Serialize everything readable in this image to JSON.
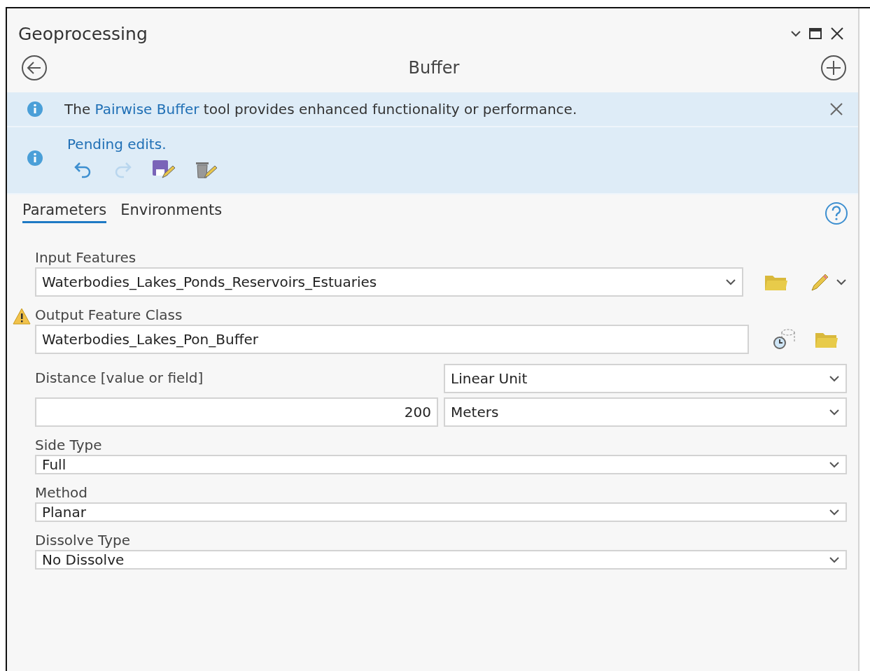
{
  "pane": {
    "title": "Geoprocessing",
    "tool": "Buffer"
  },
  "messages": [
    {
      "kind": "link",
      "before": "The ",
      "link": "Pairwise Buffer",
      "after": " tool provides enhanced functionality or performance.",
      "closable": true
    },
    {
      "kind": "edits",
      "text": "Pending edits.",
      "tools": [
        {
          "kind": "undo",
          "disabled": false
        },
        {
          "kind": "redo",
          "disabled": true
        },
        {
          "kind": "save",
          "disabled": false
        },
        {
          "kind": "discard",
          "disabled": false
        }
      ]
    }
  ],
  "tabs": [
    {
      "label": "Parameters",
      "selected": true
    },
    {
      "label": "Environments",
      "selected": false
    }
  ],
  "parameters": [
    {
      "kind": "input",
      "label": "Input Features",
      "value": "Waterbodies_Lakes_Ponds_Reservoirs_Estuaries",
      "warning": false
    },
    {
      "kind": "output",
      "label": "Output Feature Class",
      "value": "Waterbodies_Lakes_Pon_Buffer",
      "warning": true
    },
    {
      "kind": "distance",
      "label": "Distance [value or field]",
      "value": "200",
      "type": "Linear Unit",
      "unit": "Meters",
      "warning": false
    },
    {
      "kind": "dropdown",
      "label": "Side Type",
      "value": "Full",
      "warning": false
    },
    {
      "kind": "dropdown",
      "label": "Method",
      "value": "Planar",
      "warning": false
    },
    {
      "kind": "dropdown",
      "label": "Dissolve Type",
      "value": "No Dissolve",
      "warning": false
    }
  ]
}
